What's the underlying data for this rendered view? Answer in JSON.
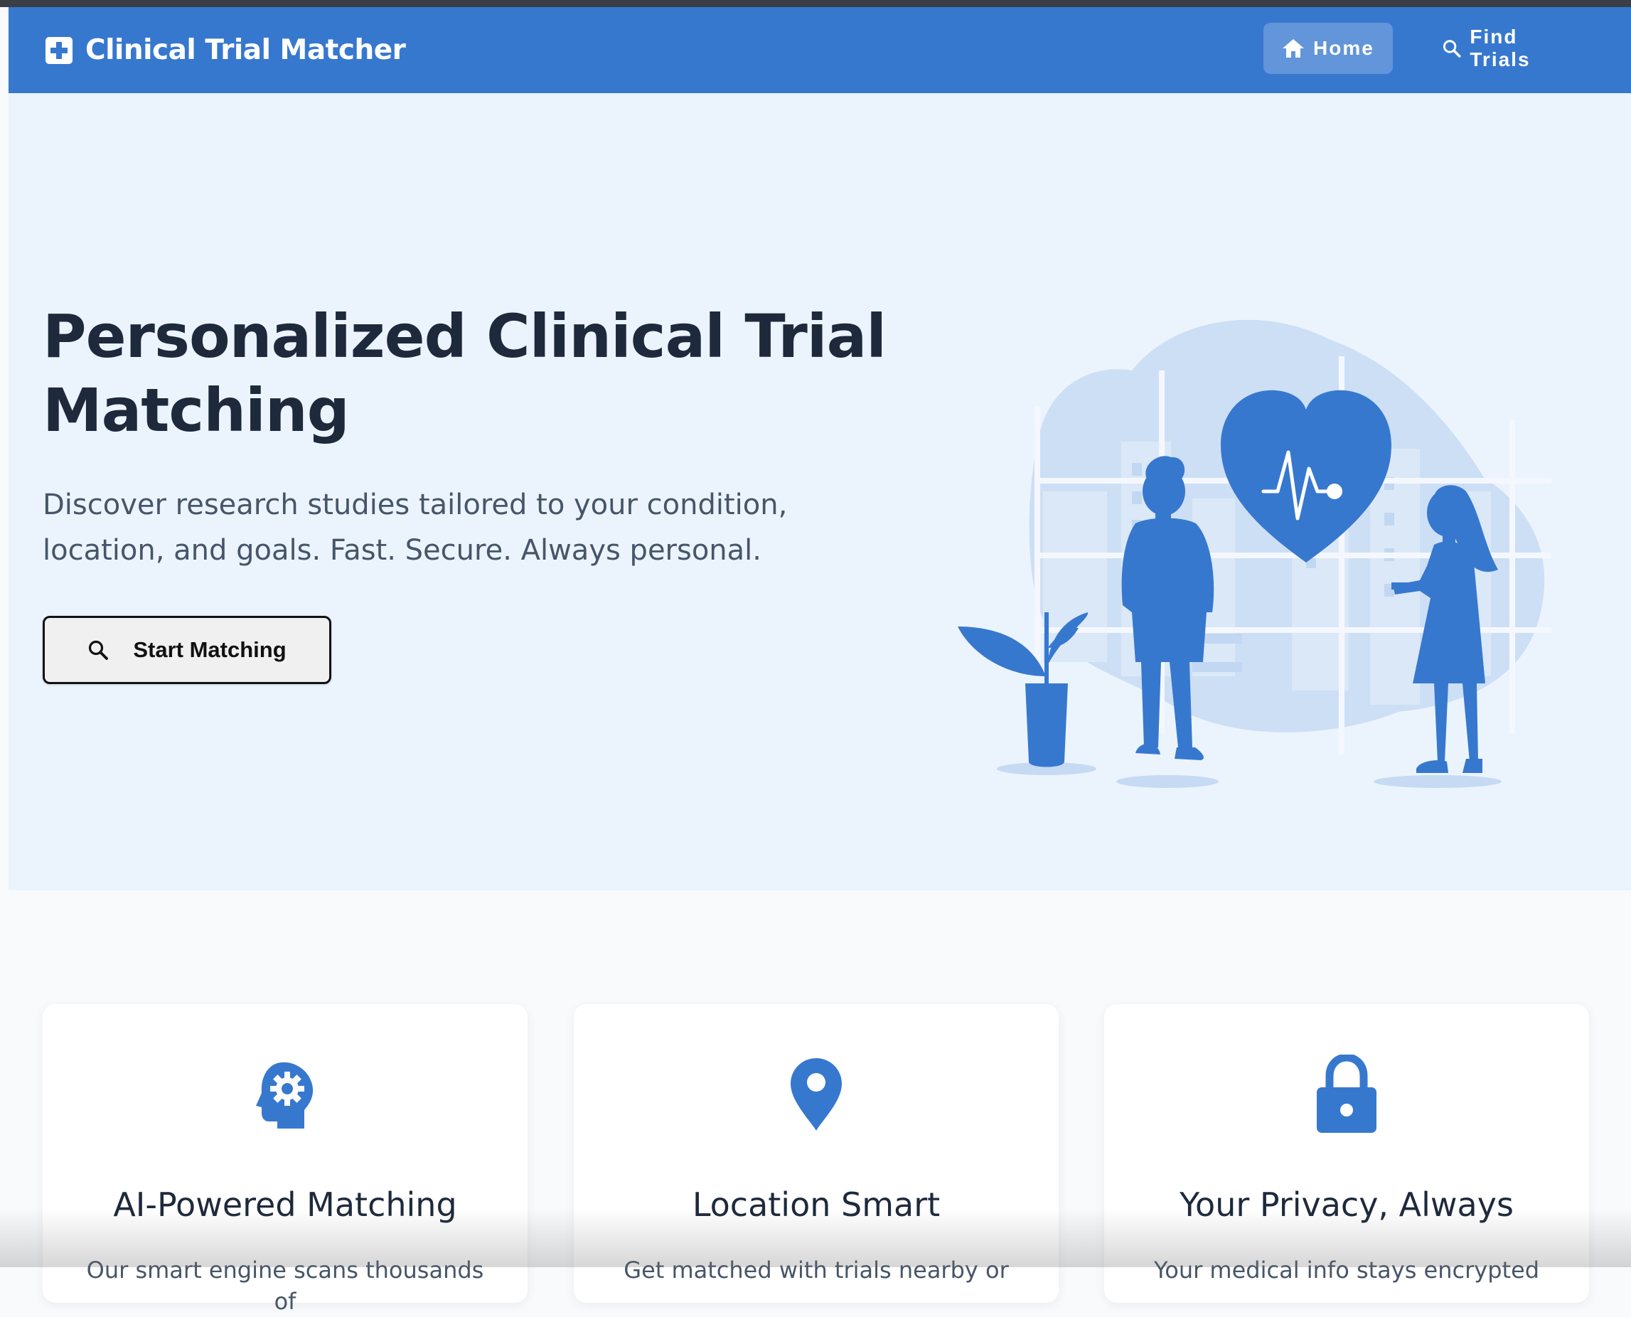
{
  "brand": {
    "title": "Clinical Trial Matcher",
    "icon": "medical-cross-icon"
  },
  "nav": {
    "items": [
      {
        "label": "Home",
        "icon": "home-icon",
        "active": true
      },
      {
        "label": "Find Trials",
        "icon": "search-icon",
        "active": false
      }
    ]
  },
  "hero": {
    "title": "Personalized Clinical Trial Matching",
    "subtitle": "Discover research studies tailored to your condition, location, and goals. Fast. Secure. Always personal.",
    "cta_label": "Start Matching",
    "cta_icon": "search-icon"
  },
  "features": [
    {
      "icon": "brain-gear-icon",
      "title": "AI-Powered Matching",
      "text": "Our smart engine scans thousands of"
    },
    {
      "icon": "location-pin-icon",
      "title": "Location Smart",
      "text": "Get matched with trials nearby or"
    },
    {
      "icon": "lock-icon",
      "title": "Your Privacy, Always",
      "text": "Your medical info stays encrypted"
    }
  ],
  "colors": {
    "primary": "#3778cf",
    "hero_background": "#ebf4fd",
    "page_background": "#f8fafc",
    "heading": "#1e293b",
    "body_text": "#475569"
  }
}
